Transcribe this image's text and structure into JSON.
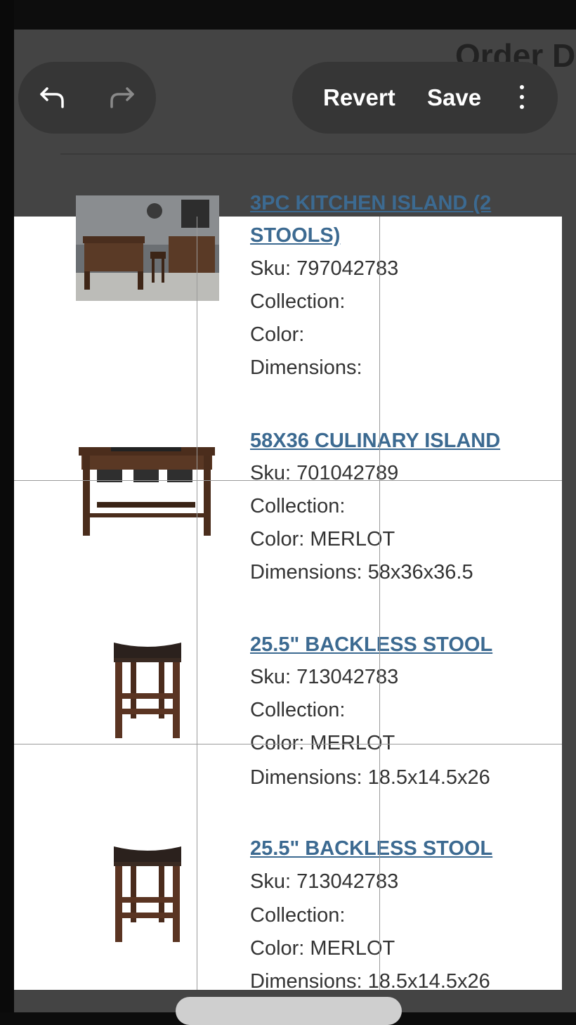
{
  "page": {
    "title_fragment": "Order D"
  },
  "toolbar": {
    "undo_icon": "undo-icon",
    "redo_icon": "redo-icon",
    "revert_label": "Revert",
    "save_label": "Save",
    "more_icon": "more-vertical-icon"
  },
  "products": [
    {
      "name_line1": "3PC KITCHEN ISLAND (2",
      "name_line2": "STOOLS)",
      "sku": "Sku: 797042783",
      "collection": "Collection:",
      "color": "Color:",
      "dimensions": "Dimensions:"
    },
    {
      "name_line1": "58X36 CULINARY ISLAND",
      "sku": "Sku: 701042789",
      "collection": "Collection:",
      "color": "Color: MERLOT",
      "dimensions": "Dimensions: 58x36x36.5"
    },
    {
      "name_line1": "25.5\" BACKLESS STOOL",
      "sku": "Sku: 713042783",
      "collection": "Collection:",
      "color": "Color: MERLOT",
      "dimensions": "Dimensions: 18.5x14.5x26"
    },
    {
      "name_line1": "25.5\" BACKLESS STOOL",
      "sku": "Sku: 713042783",
      "collection": "Collection:",
      "color": "Color: MERLOT",
      "dimensions": "Dimensions: 18.5x14.5x26"
    }
  ]
}
